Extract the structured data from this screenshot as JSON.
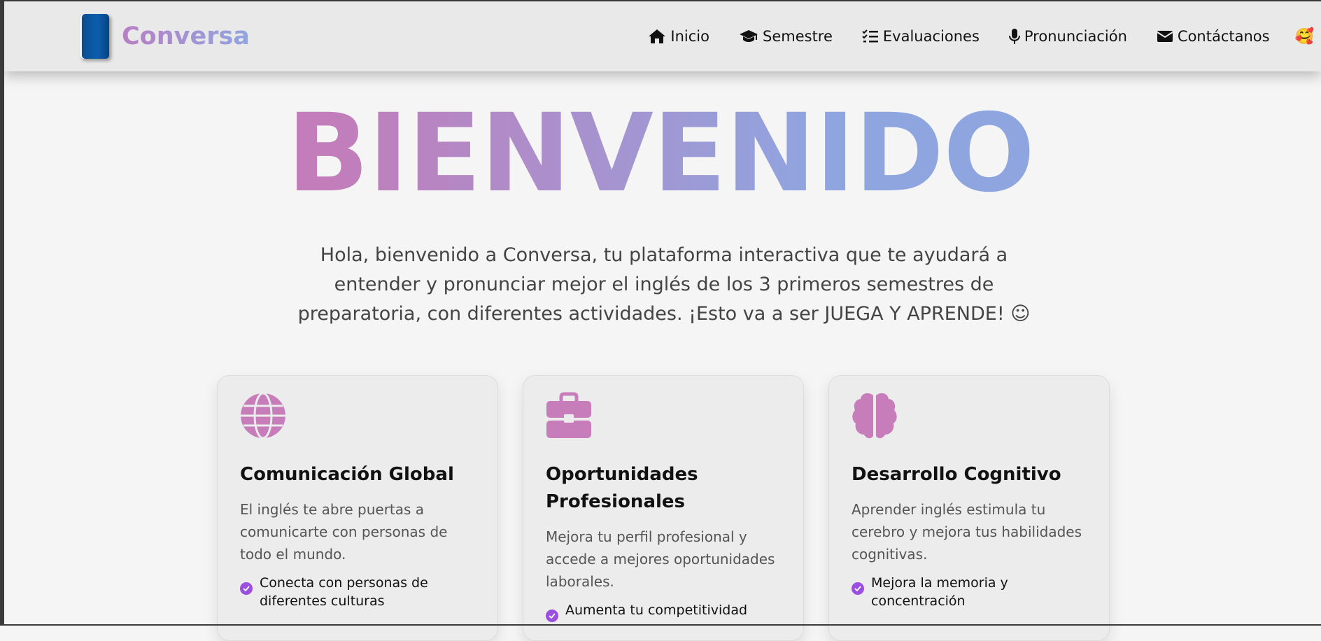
{
  "brand": {
    "name": "Conversa"
  },
  "nav": [
    {
      "label": "Inicio",
      "icon": "home-icon"
    },
    {
      "label": "Semestre",
      "icon": "graduation-cap-icon"
    },
    {
      "label": "Evaluaciones",
      "icon": "checklist-icon"
    },
    {
      "label": "Pronunciación",
      "icon": "microphone-icon"
    },
    {
      "label": "Contáctanos",
      "icon": "envelope-icon"
    }
  ],
  "user": {
    "avatar": "🥰"
  },
  "hero": {
    "title": "BIENVENIDO",
    "text": "Hola, bienvenido a Conversa, tu plataforma interactiva que te ayudará a entender y pronunciar mejor el inglés de los 3 primeros semestres de preparatoria, con diferentes actividades. ¡Esto va a ser JUEGA Y APRENDE! ☺"
  },
  "cards": [
    {
      "icon": "globe-icon",
      "title": "Comunicación Global",
      "desc": "El inglés te abre puertas a comunicarte con personas de todo el mundo.",
      "feature": "Conecta con personas de diferentes culturas"
    },
    {
      "icon": "briefcase-icon",
      "title": "Oportunidades Profesionales",
      "desc": "Mejora tu perfil profesional y accede a mejores oportunidades laborales.",
      "feature": "Aumenta tu competitividad"
    },
    {
      "icon": "brain-icon",
      "title": "Desarrollo Cognitivo",
      "desc": "Aprender inglés estimula tu cerebro y mejora tus habilidades cognitivas.",
      "feature": "Mejora la memoria y concentración"
    }
  ],
  "colors": {
    "accent": "#c77dba",
    "gradient_end": "#8fa5e0",
    "check": "#9b4fe0"
  }
}
